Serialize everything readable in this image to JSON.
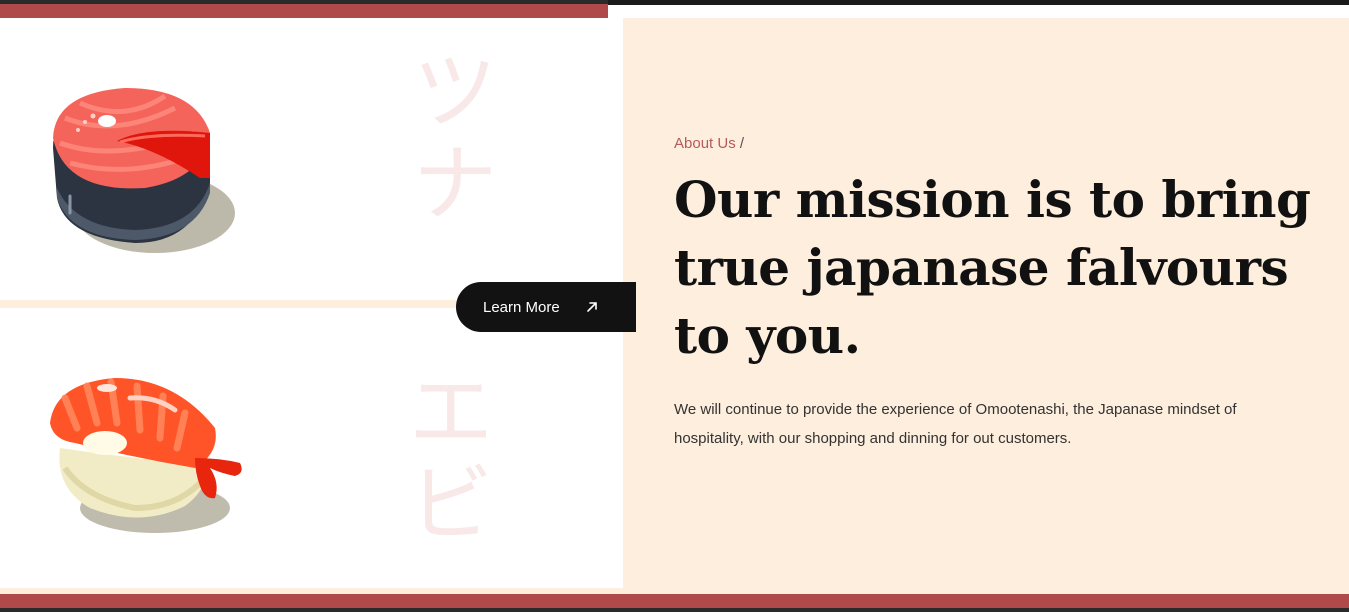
{
  "left": {
    "kana_top": [
      "ツ",
      "ナ"
    ],
    "kana_bottom": [
      "エ",
      "ビ"
    ],
    "learn_more_label": "Learn More"
  },
  "right": {
    "eyebrow": "About Us",
    "eyebrow_separator": "/",
    "headline": "Our mission is to bring true japanase falvours to you.",
    "paragraph": "We will continue to provide the experience of Omootenashi, the Japanase mindset of hospitality, with our shopping and dinning for out customers."
  },
  "colors": {
    "accent_red": "#b04a4a",
    "cream": "#fdeedd",
    "button_dark": "#121212",
    "eyebrow": "#b65a5a"
  },
  "icons": {
    "button_icon": "arrow-up-right-icon",
    "top_illustration": "salmon-steak-illustration",
    "bottom_illustration": "shrimp-nigiri-illustration"
  }
}
